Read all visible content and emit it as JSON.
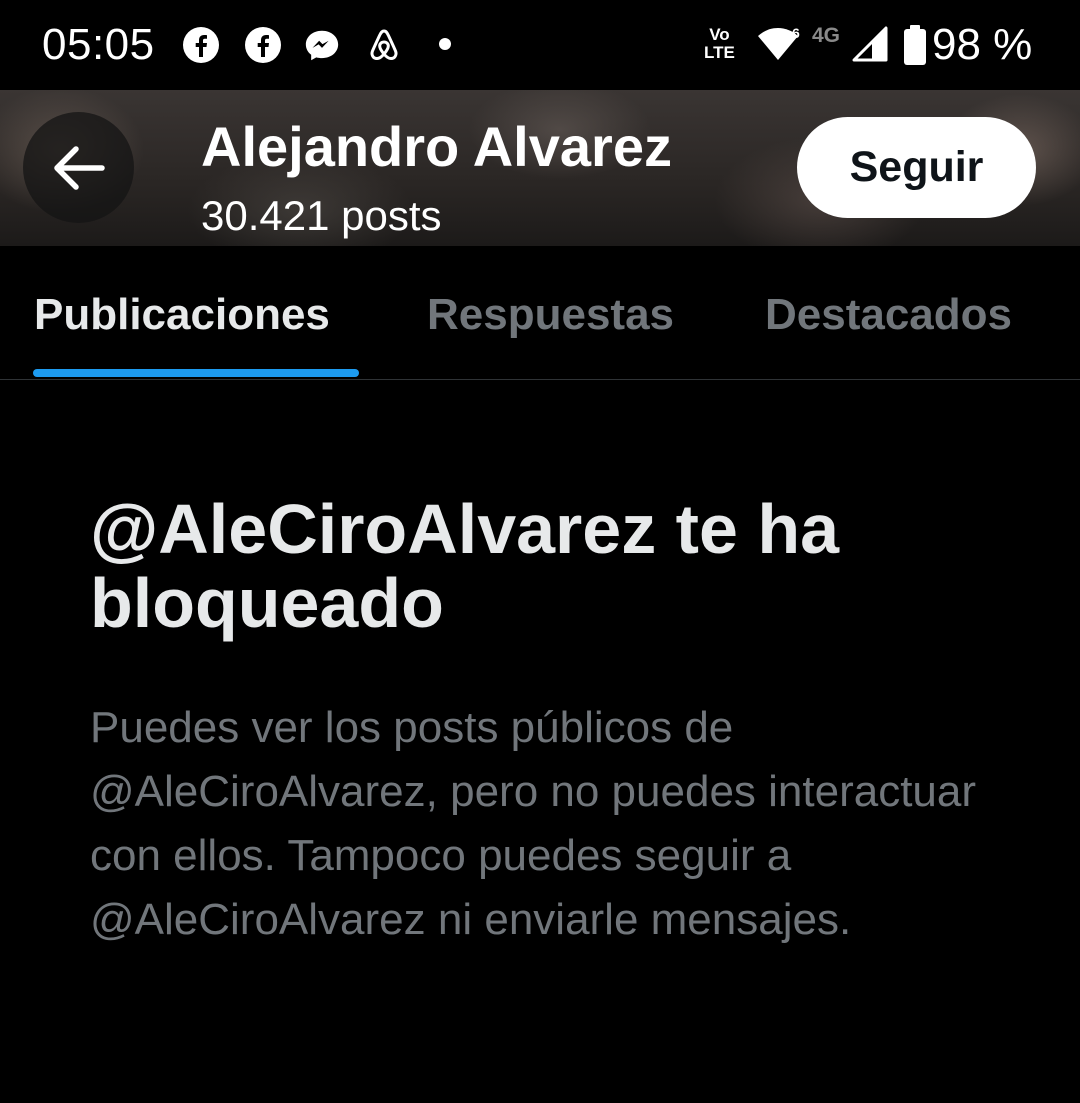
{
  "status_bar": {
    "time": "05:05",
    "left_icons": [
      "facebook-icon",
      "facebook-icon",
      "messenger-icon",
      "airbnb-icon"
    ],
    "volte_top": "Vo",
    "volte_bottom": "LTE",
    "network_label": "4G",
    "battery_percent": "98 %"
  },
  "header": {
    "name": "Alejandro Alvarez",
    "posts": "30.421 posts",
    "follow_label": "Seguir"
  },
  "tabs": [
    {
      "label": "Publicaciones",
      "active": true
    },
    {
      "label": "Respuestas",
      "active": false
    },
    {
      "label": "Destacados",
      "active": false
    }
  ],
  "blocked": {
    "title": "@AleCiroAlvarez te ha bloqueado",
    "description": "Puedes ver los posts públicos de @AleCiroAlvarez, pero no puedes interactuar con ellos. Tampoco puedes seguir a @AleCiroAlvarez ni enviarle mensajes."
  },
  "colors": {
    "background": "#000000",
    "accent": "#1d9bf0",
    "primary_text": "#e7e9ea",
    "secondary_text": "#71767b",
    "divider": "#2f3336"
  }
}
